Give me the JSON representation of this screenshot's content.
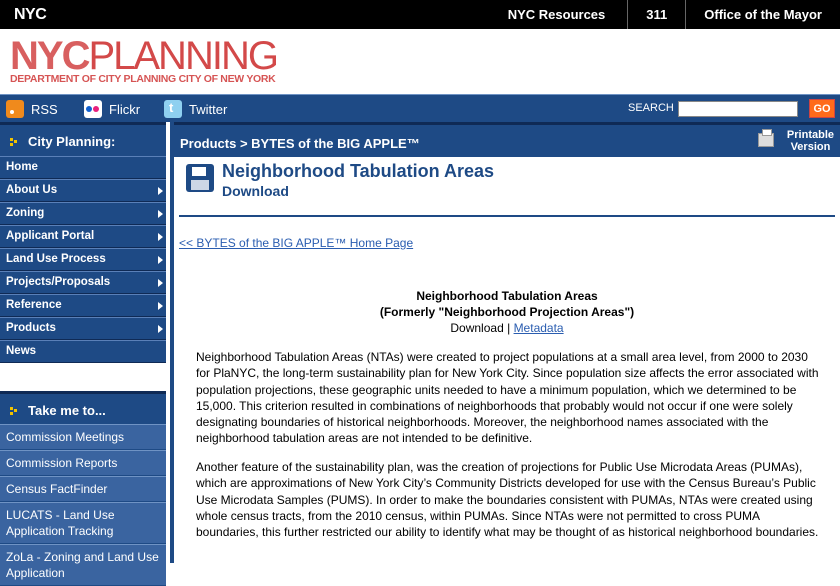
{
  "topbar": {
    "logo": "NYC",
    "links": [
      "NYC Resources",
      "311",
      "Office of the Mayor"
    ]
  },
  "logo": {
    "nyc": "NYC",
    "planning": "PLANNING",
    "department": "DEPARTMENT OF CITY PLANNING",
    "city": "CITY OF NEW YORK"
  },
  "social": {
    "rss": "RSS",
    "flickr": "Flickr",
    "twitter": "Twitter"
  },
  "search": {
    "label": "SEARCH",
    "value": "",
    "go": "GO"
  },
  "sidebar": {
    "title": "City Planning:",
    "items": [
      {
        "label": "Home",
        "has_arrow": false
      },
      {
        "label": "About Us",
        "has_arrow": true
      },
      {
        "label": "Zoning",
        "has_arrow": true
      },
      {
        "label": "Applicant Portal",
        "has_arrow": true
      },
      {
        "label": "Land Use Process",
        "has_arrow": true
      },
      {
        "label": "Projects/Proposals",
        "has_arrow": true
      },
      {
        "label": "Reference",
        "has_arrow": true
      },
      {
        "label": "Products",
        "has_arrow": true
      },
      {
        "label": "News",
        "has_arrow": false
      }
    ],
    "take_title": "Take me to...",
    "take_items": [
      "Commission Meetings",
      "Commission Reports",
      "Census FactFinder",
      "LUCATS - Land Use Application Tracking",
      "ZoLa - Zoning and Land Use Application"
    ]
  },
  "main": {
    "breadcrumb": "Products > BYTES of the BIG APPLE™",
    "printable_line1": "Printable",
    "printable_line2": "Version",
    "title": "Neighborhood Tabulation Areas",
    "subtitle": "Download",
    "back_link": "<< BYTES of the BIG APPLE™ Home Page",
    "center_title": "Neighborhood Tabulation Areas",
    "center_sub": "(Formerly \"Neighborhood Projection Areas\")",
    "download_label": "Download",
    "separator": "|",
    "metadata_link": "Metadata",
    "paragraph1": "Neighborhood Tabulation Areas (NTAs) were created to project populations at a small area level, from 2000 to 2030 for PlaNYC, the long-term sustainability plan for New York City. Since population size affects the error associated with population projections, these geographic units needed to have a minimum population, which we determined to be 15,000.  This criterion resulted in combinations of neighborhoods that probably would not occur if one were solely designating boundaries of historical neighborhoods. Moreover, the neighborhood names associated with the neighborhood tabulation areas are not intended to be definitive.",
    "paragraph2": "Another feature of the sustainability plan, was the creation of projections for Public Use Microdata Areas (PUMAs), which are approximations of New York City’s Community Districts developed for use with the Census Bureau’s Public Use Microdata Samples (PUMS).  In order to make the boundaries consistent with PUMAs, NTAs were created using whole census tracts, from the 2010 census, within PUMAs. Since NTAs were not permitted to cross PUMA boundaries, this further restricted our ability to identify what may be thought of as historical neighborhood boundaries."
  },
  "colors": {
    "nav_blue": "#1e4a85",
    "link_blue": "#2a5db0",
    "logo_red": "#cc2a2a",
    "go_orange": "#ff6a1a"
  }
}
